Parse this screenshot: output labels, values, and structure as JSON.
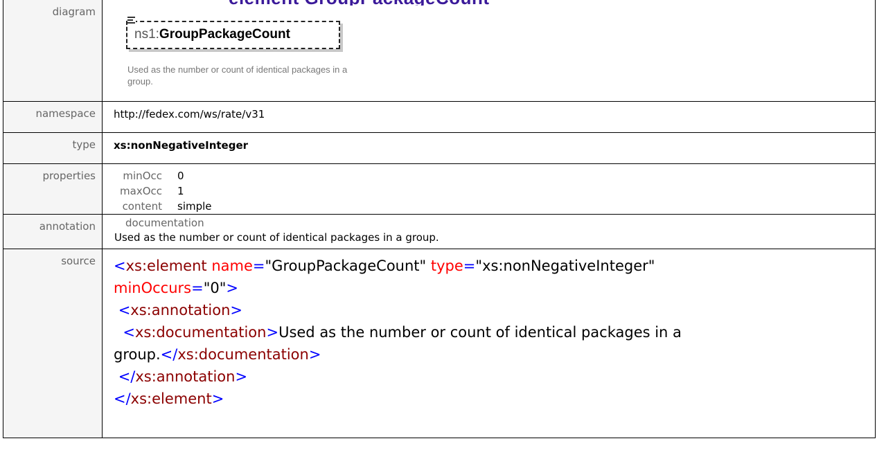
{
  "page": {
    "heading": "element GroupPackageCount"
  },
  "labels": {
    "diagram": "diagram",
    "namespace": "namespace",
    "type": "type",
    "properties": "properties",
    "annotation": "annotation",
    "source": "source"
  },
  "diagram": {
    "prefix": "ns1:",
    "name": "GroupPackageCount",
    "description": "Used as the number or count of identical packages in a group.",
    "icon": "documentation-icon"
  },
  "namespace": "http://fedex.com/ws/rate/v31",
  "type": "xs:nonNegativeInteger",
  "properties": [
    {
      "key": "minOcc",
      "value": "0"
    },
    {
      "key": "maxOcc",
      "value": "1"
    },
    {
      "key": "content",
      "value": "simple"
    }
  ],
  "annotation": {
    "heading": "documentation",
    "text": "Used as the number or count of identical packages in a group."
  },
  "source": {
    "line1_tag": "xs:element",
    "line1_attr1": "name",
    "line1_val1": "\"GroupPackageCount\"",
    "line1_attr2": "type",
    "line1_val2": "\"xs:nonNegativeInteger\"",
    "line2_attr": "minOccurs",
    "line2_val": "\"0\"",
    "line3_tag": "xs:annotation",
    "line4_tag": "xs:documentation",
    "line4_text": "Used as the number or count of identical packages in a",
    "line5_text": "group.",
    "line5_tag": "xs:documentation",
    "line6_tag": "xs:annotation",
    "line7_tag": "xs:element"
  },
  "colors": {
    "tag": "#8b0000",
    "punct": "#0000ff",
    "attr": "#ff0000",
    "label_bg": "#f5f5f5"
  }
}
